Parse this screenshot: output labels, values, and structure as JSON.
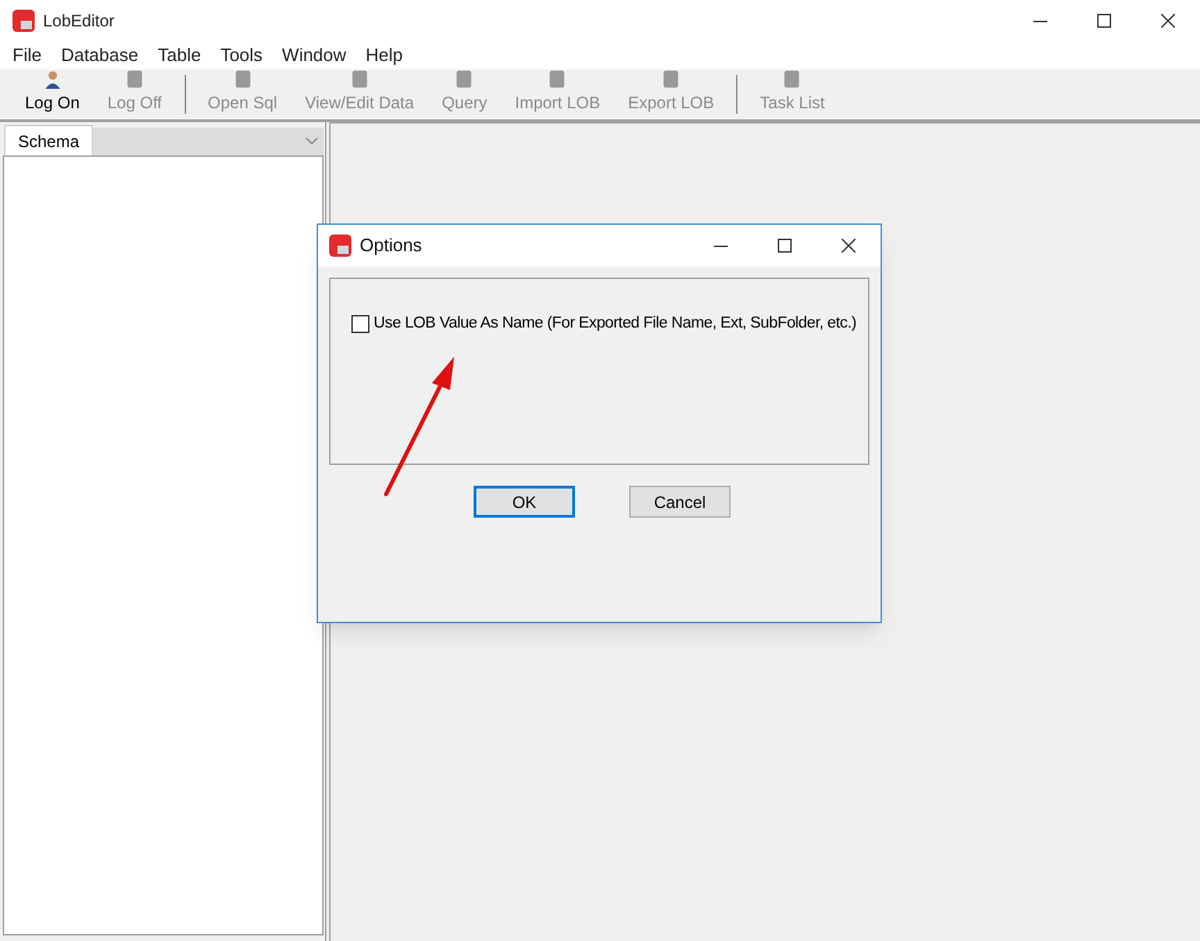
{
  "window": {
    "title": "LobEditor"
  },
  "menu": [
    "File",
    "Database",
    "Table",
    "Tools",
    "Window",
    "Help"
  ],
  "toolbar": {
    "groups": [
      [
        {
          "label": "Log On",
          "enabled": true
        },
        {
          "label": "Log Off",
          "enabled": false
        }
      ],
      [
        {
          "label": "Open Sql",
          "enabled": false
        },
        {
          "label": "View/Edit Data",
          "enabled": false
        },
        {
          "label": "Query",
          "enabled": false
        },
        {
          "label": "Import LOB",
          "enabled": false
        },
        {
          "label": "Export LOB",
          "enabled": false
        }
      ],
      [
        {
          "label": "Task List",
          "enabled": false
        }
      ]
    ]
  },
  "schema": {
    "label": "Schema",
    "disabled": true
  },
  "dialog": {
    "title": "Options",
    "option": {
      "label": "Use LOB Value As Name (For Exported File Name, Ext, SubFolder, etc.)",
      "checked": false
    },
    "buttons": [
      {
        "label": "OK",
        "default": true
      },
      {
        "label": "Cancel",
        "default": false
      }
    ]
  }
}
